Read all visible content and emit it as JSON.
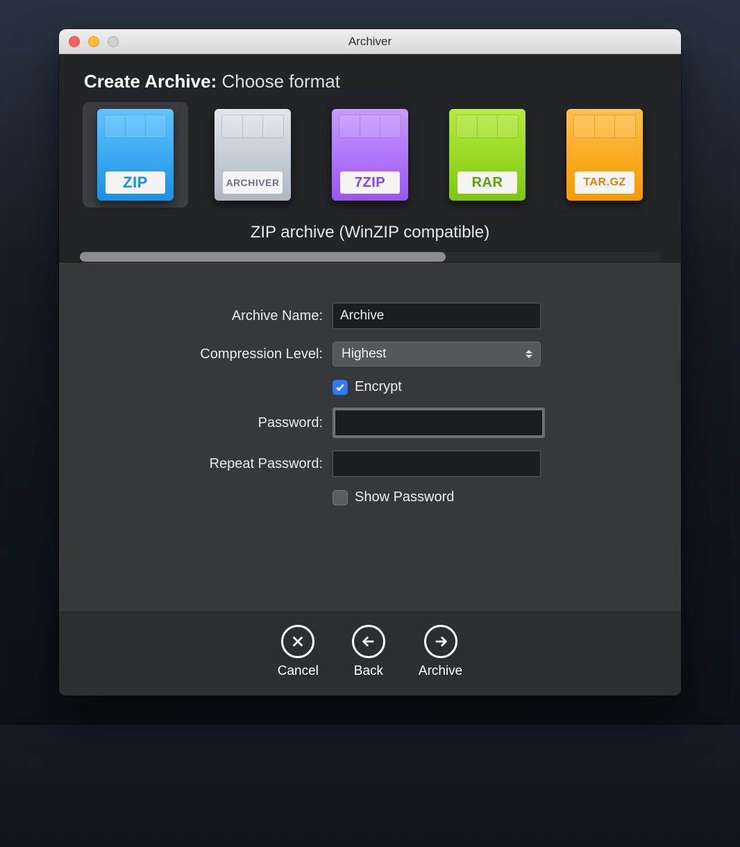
{
  "window": {
    "title": "Archiver"
  },
  "heading": {
    "strong": "Create Archive:",
    "rest": "Choose format"
  },
  "formats": [
    {
      "id": "zip",
      "label": "ZIP",
      "selected": true
    },
    {
      "id": "archiver",
      "label": "ARCHIVER",
      "selected": false
    },
    {
      "id": "sevenzip",
      "label": "7ZIP",
      "selected": false
    },
    {
      "id": "rar",
      "label": "RAR",
      "selected": false
    },
    {
      "id": "targz",
      "label": "TAR.GZ",
      "selected": false
    }
  ],
  "format_description": "ZIP archive (WinZIP compatible)",
  "form": {
    "archive_name_label": "Archive Name:",
    "archive_name_value": "Archive",
    "compression_label": "Compression Level:",
    "compression_value": "Highest",
    "encrypt_label": "Encrypt",
    "encrypt_checked": true,
    "password_label": "Password:",
    "password_value": "",
    "repeat_password_label": "Repeat Password:",
    "repeat_password_value": "",
    "show_password_label": "Show Password",
    "show_password_checked": false
  },
  "buttons": {
    "cancel": "Cancel",
    "back": "Back",
    "archive": "Archive"
  }
}
